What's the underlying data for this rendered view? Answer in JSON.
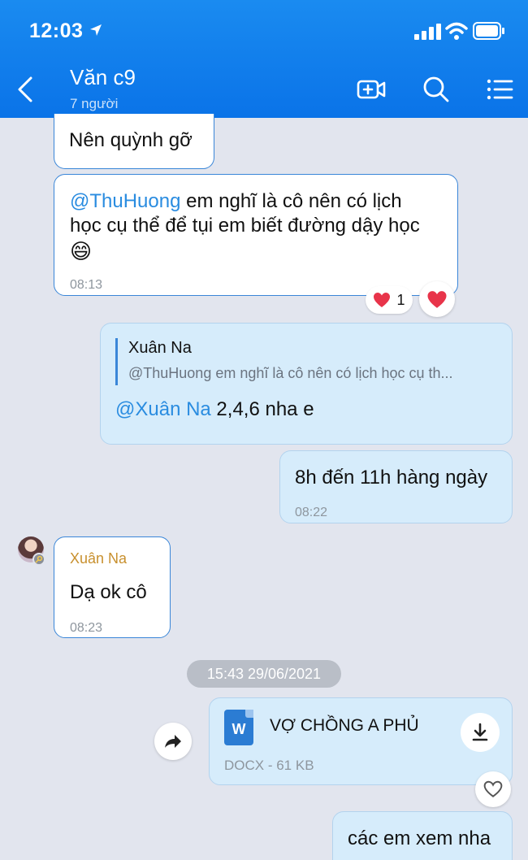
{
  "status_bar": {
    "time": "12:03"
  },
  "header": {
    "title": "Văn c9",
    "subtitle": "7 người"
  },
  "messages": {
    "m1": {
      "text": "Nên quỳnh gỡ"
    },
    "m2": {
      "mention": "@ThuHuong",
      "line1": "  em nghĩ là cô nên có lịch",
      "line2": "học cụ thể để tụi em biết đường dậy học",
      "emoji": "😄",
      "time": "08:13",
      "reaction_count": "1"
    },
    "m3": {
      "quote_author": "Xuân Na",
      "quote_text": "@ThuHuong  em nghĩ là cô nên có lịch học cụ th...",
      "mention": "@Xuân Na",
      "text": " 2,4,6 nha e"
    },
    "m4": {
      "text": "8h đến 11h hàng ngày",
      "time": "08:22"
    },
    "m5": {
      "sender": "Xuân Na",
      "text": "Dạ ok cô",
      "time": "08:23"
    },
    "date_separator": "15:43 29/06/2021",
    "file": {
      "name": "VỢ CHỒNG A PHỦ",
      "meta": "DOCX - 61 KB",
      "badge": "W"
    },
    "m6": {
      "text": "các em xem nha"
    }
  },
  "colors": {
    "header": "#0a73e8",
    "mention": "#2a8ce0",
    "sender_name": "#c8902e",
    "outgoing_bubble": "#d6ecfb",
    "background": "#e2e5ee"
  }
}
